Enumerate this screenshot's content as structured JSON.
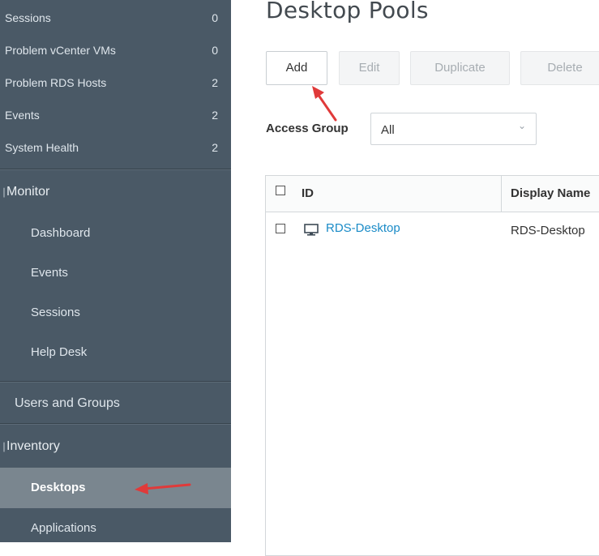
{
  "sidebar": {
    "stats": [
      {
        "label": "Sessions",
        "count": "0"
      },
      {
        "label": "Problem vCenter VMs",
        "count": "0"
      },
      {
        "label": "Problem RDS Hosts",
        "count": "2"
      },
      {
        "label": "Events",
        "count": "2"
      },
      {
        "label": "System Health",
        "count": "2"
      }
    ],
    "monitor": {
      "label": "Monitor",
      "items": [
        "Dashboard",
        "Events",
        "Sessions",
        "Help Desk"
      ]
    },
    "users_groups": "Users and Groups",
    "inventory": {
      "label": "Inventory",
      "items": [
        "Desktops",
        "Applications"
      ]
    }
  },
  "main": {
    "title": "Desktop Pools",
    "buttons": {
      "add": "Add",
      "edit": "Edit",
      "duplicate": "Duplicate",
      "delete": "Delete"
    },
    "access_group": {
      "label": "Access Group",
      "value": "All"
    },
    "table": {
      "columns": [
        "ID",
        "Display Name"
      ],
      "rows": [
        {
          "id": "RDS-Desktop",
          "display_name": "RDS-Desktop"
        }
      ]
    }
  },
  "colors": {
    "sidebar_bg": "#4a5966",
    "active_item_bg": "#7a868f",
    "link": "#1a8bc7",
    "annotation_arrow": "#e03a3a"
  }
}
